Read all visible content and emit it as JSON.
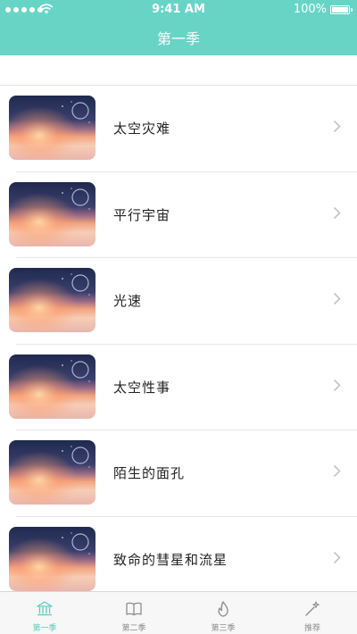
{
  "status_bar": {
    "time": "9:41 AM",
    "battery": "100%"
  },
  "header": {
    "title": "第一季"
  },
  "episodes": [
    {
      "title": "太空灾难"
    },
    {
      "title": "平行宇宙"
    },
    {
      "title": "光速"
    },
    {
      "title": "太空性事"
    },
    {
      "title": "陌生的面孔"
    },
    {
      "title": "致命的彗星和流星"
    }
  ],
  "tabs": [
    {
      "label": "第一季",
      "icon": "bank-icon",
      "active": true
    },
    {
      "label": "第二季",
      "icon": "book-icon",
      "active": false
    },
    {
      "label": "第三季",
      "icon": "flame-icon",
      "active": false
    },
    {
      "label": "推荐",
      "icon": "magic-wand-icon",
      "active": false
    }
  ],
  "colors": {
    "header": "#67d4c6",
    "active_tab": "#5ccbbd",
    "inactive_tab": "#8c8c8c"
  }
}
